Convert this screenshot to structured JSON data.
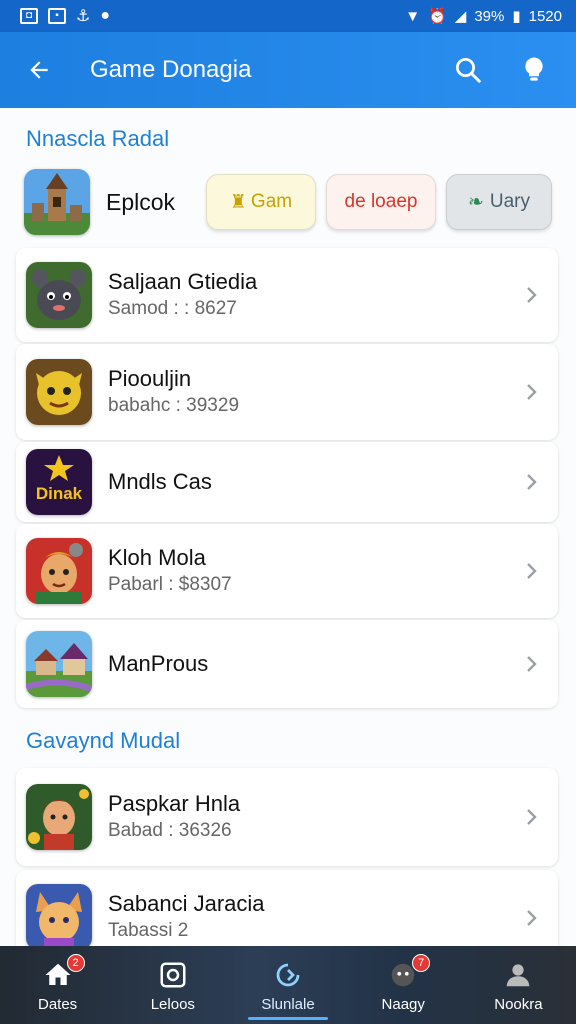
{
  "status_bar": {
    "battery": "39%",
    "time": "1520"
  },
  "app_bar": {
    "title": "Game Donagia"
  },
  "section1": {
    "title": "Nnascla Radal",
    "featured": {
      "name": "Eplcok",
      "chips": [
        "Gam",
        "de loaep",
        "Uary"
      ]
    }
  },
  "games": [
    {
      "name": "Saljaan Gtiedia",
      "sub": "Samod : : 8627"
    },
    {
      "name": "Pioouljin",
      "sub": "babahc : 39329"
    },
    {
      "name": "Mndls Cas",
      "sub": "",
      "icon_text": "Dinak"
    },
    {
      "name": "Kloh Mola",
      "sub": "Pabarl : $8307"
    },
    {
      "name": "ManProus",
      "sub": ""
    }
  ],
  "section2": {
    "title": "Gavaynd Mudal"
  },
  "games2": [
    {
      "name": "Paspkar Hnla",
      "sub": "Babad : 36326"
    },
    {
      "name": "Sabanci Jaracia",
      "sub": "Tabassi 2"
    }
  ],
  "bottom_nav": [
    {
      "label": "Dates",
      "badge": "2"
    },
    {
      "label": "Leloos",
      "badge": ""
    },
    {
      "label": "Slunlale",
      "badge": ""
    },
    {
      "label": "Naagy",
      "badge": "7"
    },
    {
      "label": "Nookra",
      "badge": ""
    }
  ],
  "colors": {
    "app_bar": "#1d7fe0",
    "accent": "#1f7fd4",
    "active_nav": "#4fb3ff"
  }
}
